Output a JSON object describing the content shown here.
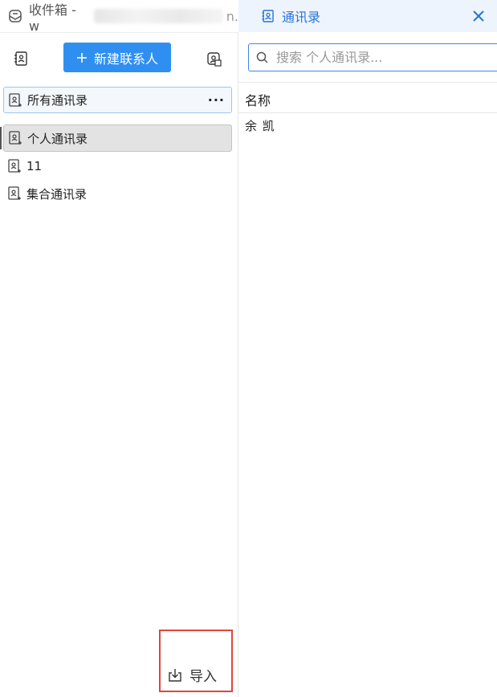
{
  "tabs": {
    "inbox_label": "收件箱 - w",
    "inbox_tail": "n.",
    "contacts_label": "通讯录"
  },
  "toolbar": {
    "new_contact_label": "新建联系人",
    "import_label": "导入"
  },
  "sidebar": {
    "all_label": "所有通讯录",
    "more_label": "···",
    "items": [
      {
        "label": "个人通讯录",
        "selected": true
      },
      {
        "label": "11",
        "selected": false
      },
      {
        "label": "集合通讯录",
        "selected": false
      }
    ]
  },
  "search": {
    "placeholder": "搜索 个人通讯录..."
  },
  "list": {
    "column_header": "名称",
    "rows": [
      {
        "name": "余 凯"
      }
    ]
  },
  "colors": {
    "accent": "#2f8ff1",
    "tab_active_bg": "#eef4fd",
    "highlight_border": "#e0453a"
  },
  "icons": [
    "mail-icon",
    "address-book-icon",
    "close-icon",
    "add-address-book-icon",
    "plus-icon",
    "import-contacts-icon",
    "search-icon",
    "import-icon"
  ]
}
